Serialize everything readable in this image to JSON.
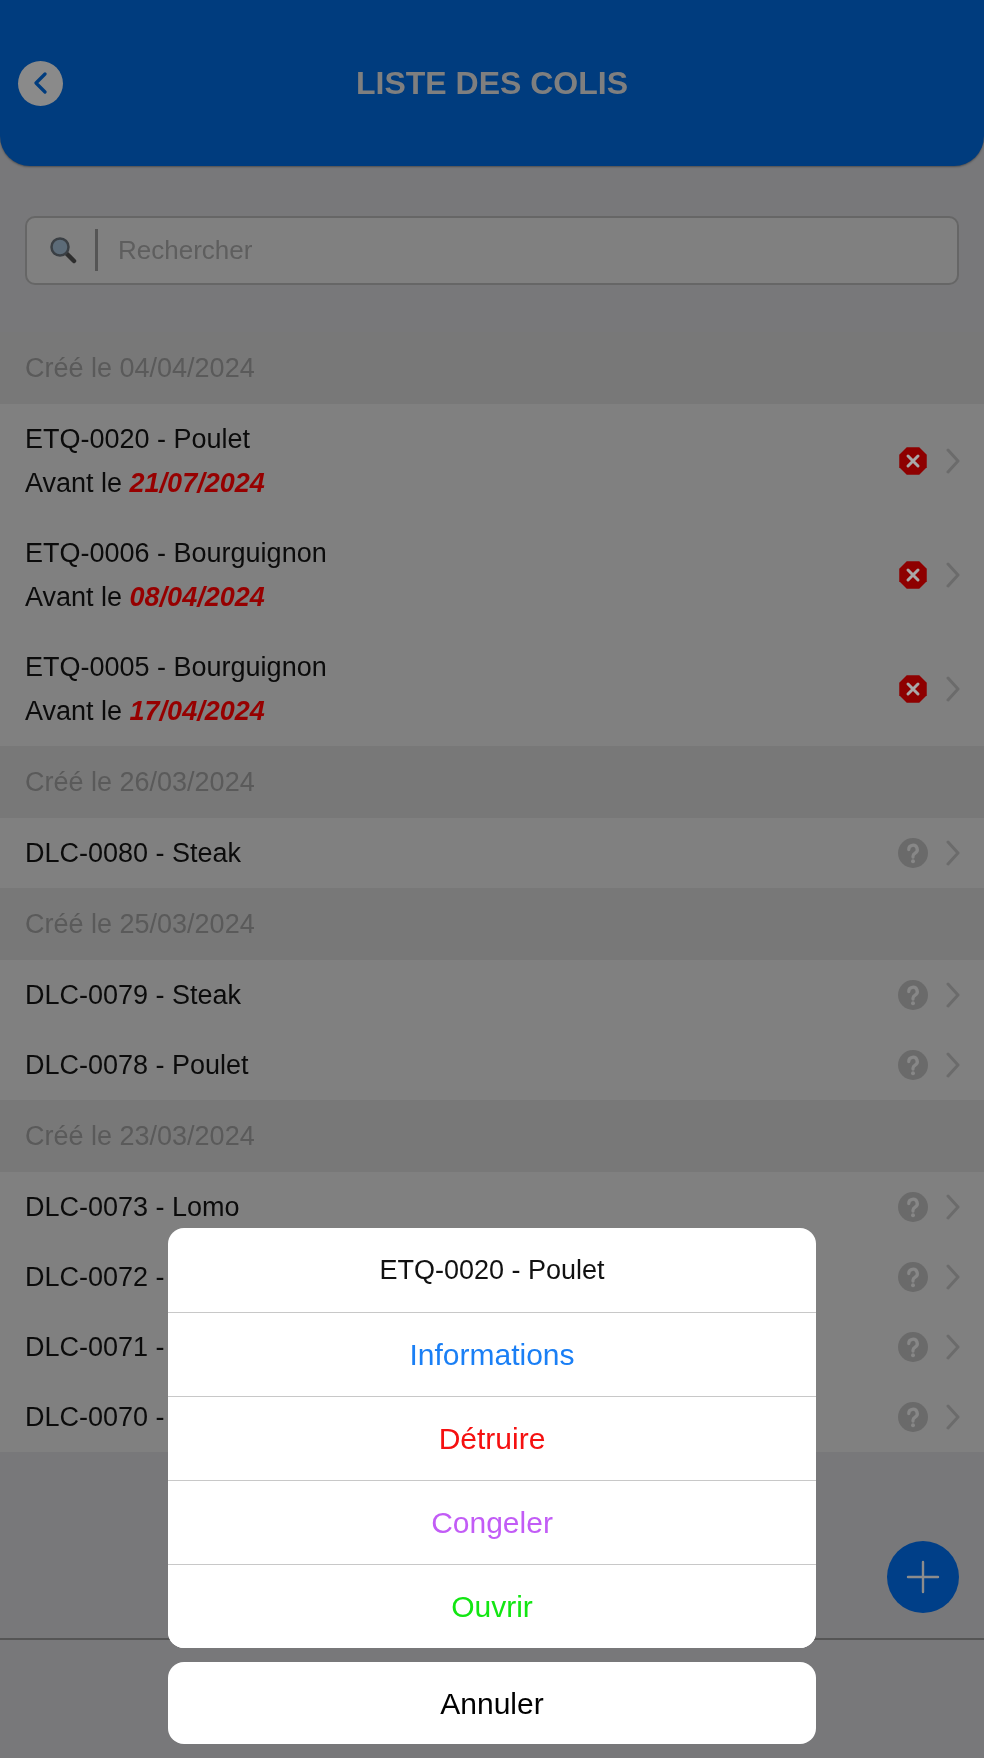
{
  "header": {
    "title": "LISTE DES COLIS"
  },
  "search": {
    "placeholder": "Rechercher"
  },
  "sections": [
    {
      "heading": "Créé le 04/04/2024",
      "items": [
        {
          "title": "ETQ-0020 - Poulet",
          "expiry": "Avant le **21/07/2024**",
          "kind": "expired"
        },
        {
          "title": "ETQ-0006 - Bourguignon",
          "expiry": "Avant le **08/04/2024**",
          "kind": "expired"
        },
        {
          "title": "ETQ-0005 - Bourguignon",
          "expiry": "Avant le **17/04/2024**",
          "kind": "expired"
        }
      ]
    },
    {
      "heading": "Créé le 26/03/2024",
      "items": [
        {
          "title": "DLC-0080 - Steak",
          "kind": "unknown"
        }
      ]
    },
    {
      "heading": "Créé le 25/03/2024",
      "items": [
        {
          "title": "DLC-0079 - Steak",
          "kind": "unknown"
        },
        {
          "title": "DLC-0078 - Poulet",
          "kind": "unknown"
        }
      ]
    },
    {
      "heading": "Créé le 23/03/2024",
      "items": [
        {
          "title": "DLC-0073 - Lomo",
          "kind": "unknown"
        },
        {
          "title": "DLC-0072 -",
          "kind": "unknown"
        },
        {
          "title": "DLC-0071 -",
          "kind": "unknown"
        },
        {
          "title": "DLC-0070 -",
          "kind": "unknown"
        }
      ]
    }
  ],
  "action_sheet": {
    "title": "ETQ-0020 - Poulet",
    "actions": [
      {
        "label": "Informations",
        "color": "#1a7ff5"
      },
      {
        "label": "Détruire",
        "color": "#f51010"
      },
      {
        "label": "Congeler",
        "color": "#c25cf6"
      },
      {
        "label": "Ouvrir",
        "color": "#12e612"
      }
    ],
    "cancel": "Annuler"
  }
}
